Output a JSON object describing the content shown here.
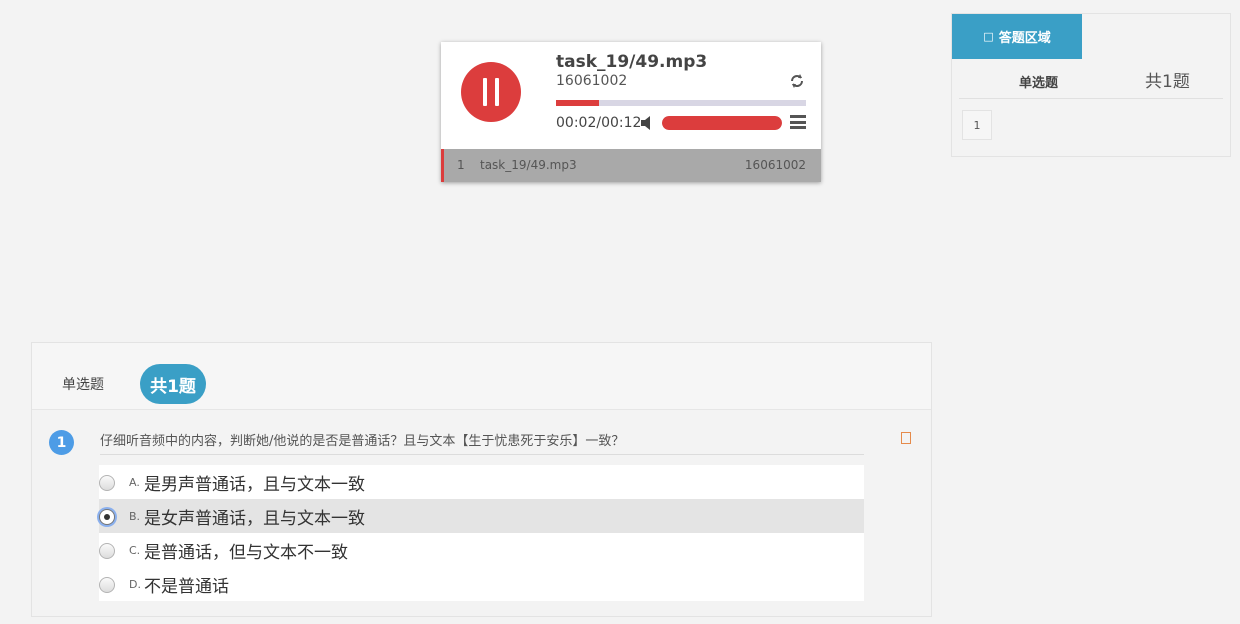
{
  "player": {
    "title": "task_19/49.mp3",
    "subtitle": "16061002",
    "time": "00:02/00:12",
    "progress": 0.17,
    "volume": 1.0,
    "playlist": [
      {
        "num": "1",
        "name": "task_19/49.mp3",
        "id": "16061002"
      }
    ]
  },
  "answer_area": {
    "tab_label": "答题区域",
    "tab_icon": "□",
    "type_label": "单选题",
    "count_label": "共1题",
    "numbers": [
      "1"
    ]
  },
  "question_panel": {
    "type_label": "单选题",
    "count_label": "共1题",
    "question": {
      "number": "1",
      "text": "仔细听音频中的内容，判断她/他说的是否是普通话？且与文本【生于忧患死于安乐】一致？",
      "flag_icon": "□",
      "options": [
        {
          "letter": "A.",
          "text": "是男声普通话，且与文本一致",
          "selected": false
        },
        {
          "letter": "B.",
          "text": "是女声普通话，且与文本一致",
          "selected": true
        },
        {
          "letter": "C.",
          "text": "是普通话，但与文本不一致",
          "selected": false
        },
        {
          "letter": "D.",
          "text": "不是普通话",
          "selected": false
        }
      ]
    }
  },
  "colors": {
    "accent_red": "#dc3d3d",
    "accent_blue": "#3a9fc6",
    "number_badge": "#4d9ce6"
  }
}
